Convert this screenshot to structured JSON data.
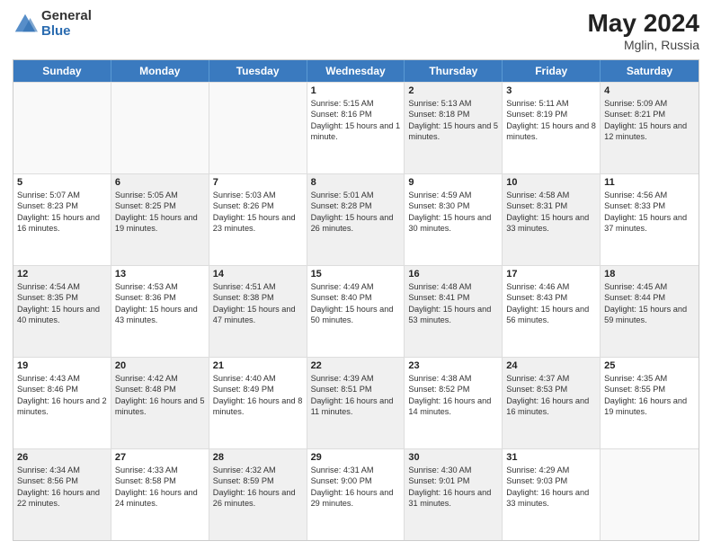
{
  "logo": {
    "general": "General",
    "blue": "Blue"
  },
  "title": {
    "month": "May 2024",
    "location": "Mglin, Russia"
  },
  "header_days": [
    "Sunday",
    "Monday",
    "Tuesday",
    "Wednesday",
    "Thursday",
    "Friday",
    "Saturday"
  ],
  "weeks": [
    [
      {
        "day": "",
        "sunrise": "",
        "sunset": "",
        "daylight": "",
        "shaded": false,
        "empty": true
      },
      {
        "day": "",
        "sunrise": "",
        "sunset": "",
        "daylight": "",
        "shaded": false,
        "empty": true
      },
      {
        "day": "",
        "sunrise": "",
        "sunset": "",
        "daylight": "",
        "shaded": false,
        "empty": true
      },
      {
        "day": "1",
        "sunrise": "Sunrise: 5:15 AM",
        "sunset": "Sunset: 8:16 PM",
        "daylight": "Daylight: 15 hours and 1 minute.",
        "shaded": false,
        "empty": false
      },
      {
        "day": "2",
        "sunrise": "Sunrise: 5:13 AM",
        "sunset": "Sunset: 8:18 PM",
        "daylight": "Daylight: 15 hours and 5 minutes.",
        "shaded": true,
        "empty": false
      },
      {
        "day": "3",
        "sunrise": "Sunrise: 5:11 AM",
        "sunset": "Sunset: 8:19 PM",
        "daylight": "Daylight: 15 hours and 8 minutes.",
        "shaded": false,
        "empty": false
      },
      {
        "day": "4",
        "sunrise": "Sunrise: 5:09 AM",
        "sunset": "Sunset: 8:21 PM",
        "daylight": "Daylight: 15 hours and 12 minutes.",
        "shaded": true,
        "empty": false
      }
    ],
    [
      {
        "day": "5",
        "sunrise": "Sunrise: 5:07 AM",
        "sunset": "Sunset: 8:23 PM",
        "daylight": "Daylight: 15 hours and 16 minutes.",
        "shaded": false,
        "empty": false
      },
      {
        "day": "6",
        "sunrise": "Sunrise: 5:05 AM",
        "sunset": "Sunset: 8:25 PM",
        "daylight": "Daylight: 15 hours and 19 minutes.",
        "shaded": true,
        "empty": false
      },
      {
        "day": "7",
        "sunrise": "Sunrise: 5:03 AM",
        "sunset": "Sunset: 8:26 PM",
        "daylight": "Daylight: 15 hours and 23 minutes.",
        "shaded": false,
        "empty": false
      },
      {
        "day": "8",
        "sunrise": "Sunrise: 5:01 AM",
        "sunset": "Sunset: 8:28 PM",
        "daylight": "Daylight: 15 hours and 26 minutes.",
        "shaded": true,
        "empty": false
      },
      {
        "day": "9",
        "sunrise": "Sunrise: 4:59 AM",
        "sunset": "Sunset: 8:30 PM",
        "daylight": "Daylight: 15 hours and 30 minutes.",
        "shaded": false,
        "empty": false
      },
      {
        "day": "10",
        "sunrise": "Sunrise: 4:58 AM",
        "sunset": "Sunset: 8:31 PM",
        "daylight": "Daylight: 15 hours and 33 minutes.",
        "shaded": true,
        "empty": false
      },
      {
        "day": "11",
        "sunrise": "Sunrise: 4:56 AM",
        "sunset": "Sunset: 8:33 PM",
        "daylight": "Daylight: 15 hours and 37 minutes.",
        "shaded": false,
        "empty": false
      }
    ],
    [
      {
        "day": "12",
        "sunrise": "Sunrise: 4:54 AM",
        "sunset": "Sunset: 8:35 PM",
        "daylight": "Daylight: 15 hours and 40 minutes.",
        "shaded": true,
        "empty": false
      },
      {
        "day": "13",
        "sunrise": "Sunrise: 4:53 AM",
        "sunset": "Sunset: 8:36 PM",
        "daylight": "Daylight: 15 hours and 43 minutes.",
        "shaded": false,
        "empty": false
      },
      {
        "day": "14",
        "sunrise": "Sunrise: 4:51 AM",
        "sunset": "Sunset: 8:38 PM",
        "daylight": "Daylight: 15 hours and 47 minutes.",
        "shaded": true,
        "empty": false
      },
      {
        "day": "15",
        "sunrise": "Sunrise: 4:49 AM",
        "sunset": "Sunset: 8:40 PM",
        "daylight": "Daylight: 15 hours and 50 minutes.",
        "shaded": false,
        "empty": false
      },
      {
        "day": "16",
        "sunrise": "Sunrise: 4:48 AM",
        "sunset": "Sunset: 8:41 PM",
        "daylight": "Daylight: 15 hours and 53 minutes.",
        "shaded": true,
        "empty": false
      },
      {
        "day": "17",
        "sunrise": "Sunrise: 4:46 AM",
        "sunset": "Sunset: 8:43 PM",
        "daylight": "Daylight: 15 hours and 56 minutes.",
        "shaded": false,
        "empty": false
      },
      {
        "day": "18",
        "sunrise": "Sunrise: 4:45 AM",
        "sunset": "Sunset: 8:44 PM",
        "daylight": "Daylight: 15 hours and 59 minutes.",
        "shaded": true,
        "empty": false
      }
    ],
    [
      {
        "day": "19",
        "sunrise": "Sunrise: 4:43 AM",
        "sunset": "Sunset: 8:46 PM",
        "daylight": "Daylight: 16 hours and 2 minutes.",
        "shaded": false,
        "empty": false
      },
      {
        "day": "20",
        "sunrise": "Sunrise: 4:42 AM",
        "sunset": "Sunset: 8:48 PM",
        "daylight": "Daylight: 16 hours and 5 minutes.",
        "shaded": true,
        "empty": false
      },
      {
        "day": "21",
        "sunrise": "Sunrise: 4:40 AM",
        "sunset": "Sunset: 8:49 PM",
        "daylight": "Daylight: 16 hours and 8 minutes.",
        "shaded": false,
        "empty": false
      },
      {
        "day": "22",
        "sunrise": "Sunrise: 4:39 AM",
        "sunset": "Sunset: 8:51 PM",
        "daylight": "Daylight: 16 hours and 11 minutes.",
        "shaded": true,
        "empty": false
      },
      {
        "day": "23",
        "sunrise": "Sunrise: 4:38 AM",
        "sunset": "Sunset: 8:52 PM",
        "daylight": "Daylight: 16 hours and 14 minutes.",
        "shaded": false,
        "empty": false
      },
      {
        "day": "24",
        "sunrise": "Sunrise: 4:37 AM",
        "sunset": "Sunset: 8:53 PM",
        "daylight": "Daylight: 16 hours and 16 minutes.",
        "shaded": true,
        "empty": false
      },
      {
        "day": "25",
        "sunrise": "Sunrise: 4:35 AM",
        "sunset": "Sunset: 8:55 PM",
        "daylight": "Daylight: 16 hours and 19 minutes.",
        "shaded": false,
        "empty": false
      }
    ],
    [
      {
        "day": "26",
        "sunrise": "Sunrise: 4:34 AM",
        "sunset": "Sunset: 8:56 PM",
        "daylight": "Daylight: 16 hours and 22 minutes.",
        "shaded": true,
        "empty": false
      },
      {
        "day": "27",
        "sunrise": "Sunrise: 4:33 AM",
        "sunset": "Sunset: 8:58 PM",
        "daylight": "Daylight: 16 hours and 24 minutes.",
        "shaded": false,
        "empty": false
      },
      {
        "day": "28",
        "sunrise": "Sunrise: 4:32 AM",
        "sunset": "Sunset: 8:59 PM",
        "daylight": "Daylight: 16 hours and 26 minutes.",
        "shaded": true,
        "empty": false
      },
      {
        "day": "29",
        "sunrise": "Sunrise: 4:31 AM",
        "sunset": "Sunset: 9:00 PM",
        "daylight": "Daylight: 16 hours and 29 minutes.",
        "shaded": false,
        "empty": false
      },
      {
        "day": "30",
        "sunrise": "Sunrise: 4:30 AM",
        "sunset": "Sunset: 9:01 PM",
        "daylight": "Daylight: 16 hours and 31 minutes.",
        "shaded": true,
        "empty": false
      },
      {
        "day": "31",
        "sunrise": "Sunrise: 4:29 AM",
        "sunset": "Sunset: 9:03 PM",
        "daylight": "Daylight: 16 hours and 33 minutes.",
        "shaded": false,
        "empty": false
      },
      {
        "day": "",
        "sunrise": "",
        "sunset": "",
        "daylight": "",
        "shaded": true,
        "empty": true
      }
    ]
  ]
}
